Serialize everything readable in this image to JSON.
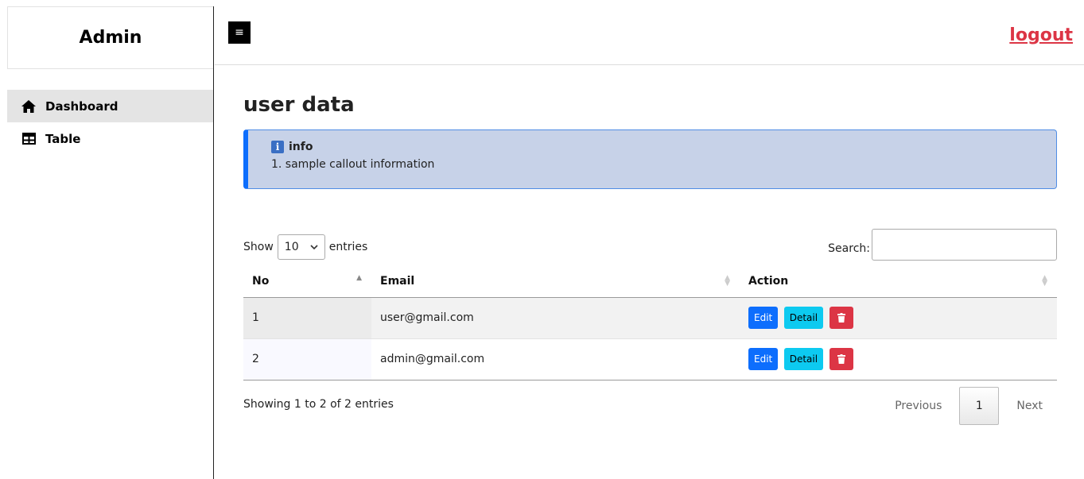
{
  "sidebar": {
    "brand": "Admin",
    "items": [
      {
        "label": "Dashboard",
        "icon": "home-icon",
        "active": true
      },
      {
        "label": "Table",
        "icon": "table-icon",
        "active": false
      }
    ]
  },
  "header": {
    "menu_icon": "≡",
    "logout_label": "logout"
  },
  "page": {
    "title": "user data"
  },
  "callout": {
    "icon": "i",
    "title": "info",
    "text": "1. sample callout information"
  },
  "datatable": {
    "show_label": "Show",
    "length_value": "10",
    "entries_label": "entries",
    "search_label": "Search:",
    "search_value": "",
    "columns": [
      "No",
      "Email",
      "Action"
    ],
    "rows": [
      {
        "no": "1",
        "email": "user@gmail.com"
      },
      {
        "no": "2",
        "email": "admin@gmail.com"
      }
    ],
    "actions": {
      "edit_label": "Edit",
      "detail_label": "Detail",
      "delete_icon": "trash-icon"
    },
    "info": "Showing 1 to 2 of 2 entries",
    "pagination": {
      "previous": "Previous",
      "current": "1",
      "next": "Next"
    }
  },
  "colors": {
    "primary": "#0d6efd",
    "info": "#0dcaf0",
    "danger": "#dc3545",
    "callout_bg": "#c7d2e8"
  }
}
